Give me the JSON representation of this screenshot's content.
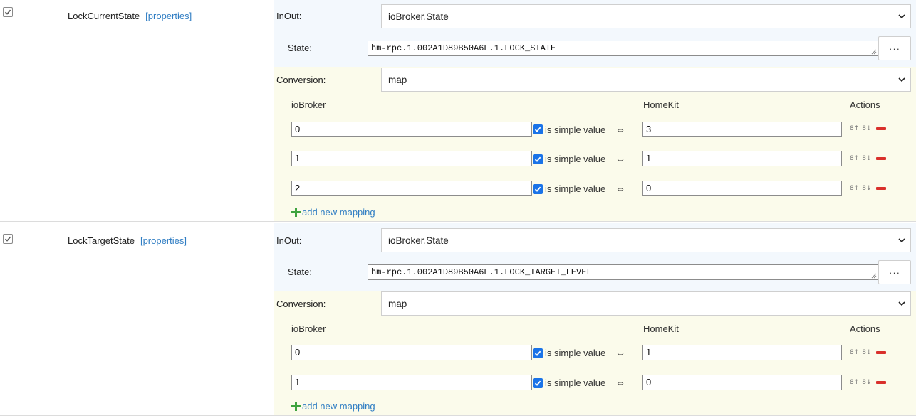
{
  "characteristics": [
    {
      "name": "LockCurrentState",
      "properties_link": "[properties]",
      "inout_label": "InOut:",
      "inout_value": "ioBroker.State",
      "state_label": "State:",
      "state_value": "hm-rpc.1.002A1D89B50A6F.1.LOCK_STATE",
      "more_button": "···",
      "conversion_label": "Conversion:",
      "conversion_value": "map",
      "col_iobroker": "ioBroker",
      "col_homekit": "HomeKit",
      "col_actions": "Actions",
      "simple_value_label": "is simple value",
      "arrow": "⇔",
      "mappings": [
        {
          "iobroker": "0",
          "homekit": "3",
          "simple": true
        },
        {
          "iobroker": "1",
          "homekit": "1",
          "simple": true
        },
        {
          "iobroker": "2",
          "homekit": "0",
          "simple": true
        }
      ],
      "add_mapping": "add new mapping"
    },
    {
      "name": "LockTargetState",
      "properties_link": "[properties]",
      "inout_label": "InOut:",
      "inout_value": "ioBroker.State",
      "state_label": "State:",
      "state_value": "hm-rpc.1.002A1D89B50A6F.1.LOCK_TARGET_LEVEL",
      "more_button": "···",
      "conversion_label": "Conversion:",
      "conversion_value": "map",
      "col_iobroker": "ioBroker",
      "col_homekit": "HomeKit",
      "col_actions": "Actions",
      "simple_value_label": "is simple value",
      "arrow": "⇔",
      "mappings": [
        {
          "iobroker": "0",
          "homekit": "1",
          "simple": true
        },
        {
          "iobroker": "1",
          "homekit": "0",
          "simple": true
        }
      ],
      "add_mapping": "add new mapping"
    }
  ],
  "icons": {
    "move_up": "8↑",
    "move_down": "8↓",
    "row_checkbox": "checkmark-icon",
    "delete": "minus-icon",
    "add": "plus-icon",
    "dropdown": "chevron-down-icon"
  },
  "colors": {
    "link": "#2f7dc3",
    "checkbox_checked": "#1a73e8",
    "delete": "#d9302b",
    "add": "#3fa33f",
    "inout_panel_bg": "#f3f8fd",
    "conversion_panel_bg": "#fbfbeb"
  }
}
